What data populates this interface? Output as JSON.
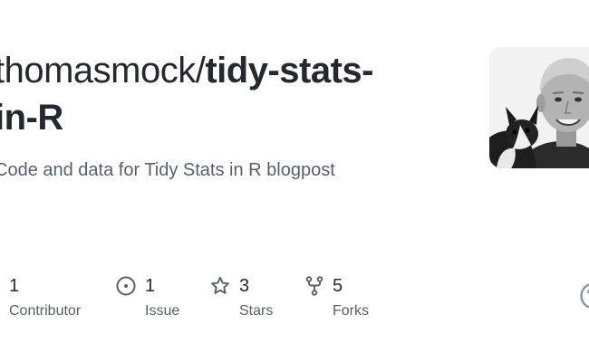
{
  "repo": {
    "owner": "thomasmock/",
    "name_line1": "tidy-stats-",
    "name_line2": "in-R",
    "description": "Code and data for Tidy Stats in R blogpost"
  },
  "stats": {
    "contributors": {
      "value": "1",
      "label": "Contributor",
      "icon": "people-icon"
    },
    "issues": {
      "value": "1",
      "label": "Issue",
      "icon": "issue-opened-icon"
    },
    "stars": {
      "value": "3",
      "label": "Stars",
      "icon": "star-icon"
    },
    "forks": {
      "value": "5",
      "label": "Forks",
      "icon": "repo-forked-icon"
    }
  },
  "colors": {
    "title": "#24292f",
    "muted": "#57606a",
    "icon": "#57606a",
    "background": "#ffffff"
  }
}
